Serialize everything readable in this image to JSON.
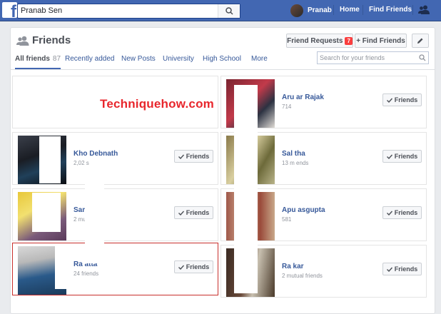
{
  "topbar": {
    "search_value": "Pranab Sen",
    "profile_name": "Pranab",
    "nav": [
      "Home",
      "Find Friends"
    ]
  },
  "header": {
    "title": "Friends",
    "friend_requests_label": "Friend Requests",
    "friend_requests_count": "7",
    "find_friends_label": "+ Find Friends"
  },
  "tabs": {
    "all_label": "All friends",
    "all_count": "87",
    "others": [
      "Recently added",
      "New Posts",
      "University",
      "High School",
      "More"
    ]
  },
  "friend_search": {
    "placeholder": "Search for your friends"
  },
  "friend_button_label": "Friends",
  "watermark": "Techniquehow.com",
  "friends": [
    {
      "name": "",
      "sub": ""
    },
    {
      "name": "Aru          ar Rajak",
      "sub": "714"
    },
    {
      "name": "Kho          Debnath",
      "sub": "2,02          s"
    },
    {
      "name": "Sal          tha",
      "sub": "13 m          ends"
    },
    {
      "name": "Sam          Das",
      "sub": "2 mu          iends"
    },
    {
      "name": "Apu          asgupta",
      "sub": "581"
    },
    {
      "name": "Ra          atta",
      "sub": "24 friends"
    },
    {
      "name": "Ra          kar",
      "sub": "2 mutual friends"
    }
  ],
  "colors": {
    "topbar": "#4267b2",
    "link": "#365899",
    "badge": "#fa3e3e",
    "watermark": "#e8262c",
    "highlight_border": "#c8302c"
  }
}
